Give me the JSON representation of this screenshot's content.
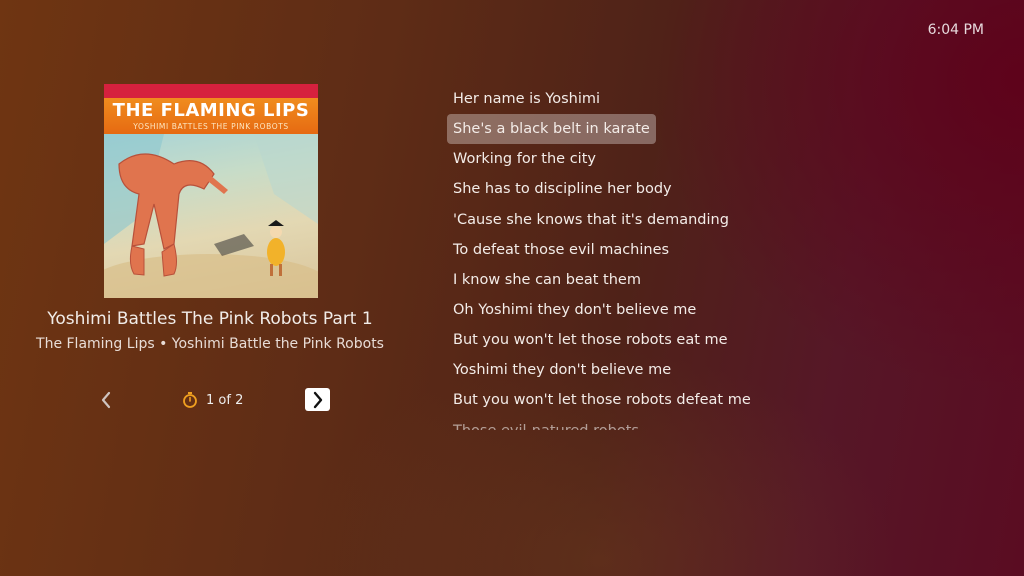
{
  "status": {
    "time": "6:04 PM"
  },
  "album_art": {
    "band": "THE FLAMING LIPS",
    "album": "YOSHIMI BATTLES THE PINK ROBOTS",
    "colors": {
      "top_strip": "#d6213e",
      "band_strip": "#e66a12"
    }
  },
  "now_playing": {
    "title": "Yoshimi Battles The Pink Robots Part 1",
    "subtitle": "The Flaming Lips • Yoshimi Battle the Pink Robots"
  },
  "controls": {
    "prev_icon": "chevron-left-icon",
    "next_icon": "chevron-right-icon",
    "timer_icon": "stopwatch-icon",
    "page_indicator": "1 of 2"
  },
  "lyrics": {
    "active_index": 1,
    "lines": [
      "Her name is Yoshimi",
      "She's a black belt in karate",
      "Working for the city",
      "She has to discipline her body",
      "'Cause she knows that it's demanding",
      "To defeat those evil machines",
      "I know she can beat them",
      "Oh Yoshimi they don't believe me",
      "But you won't let those robots eat me",
      "Yoshimi they don't believe me",
      "But you won't let those robots defeat me",
      "Those evil-natured robots"
    ]
  },
  "colors": {
    "accent": "#f0a020",
    "highlight": "rgba(255,255,255,0.32)"
  }
}
